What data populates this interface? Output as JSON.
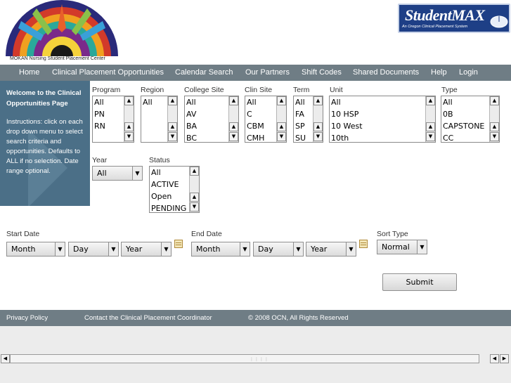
{
  "header": {
    "org_caption": "MOKAN Nursing Student Placement Center",
    "sm_logo_title": "StudentMAX",
    "sm_logo_subtitle": "An Oregon Clinical Placement System"
  },
  "nav": {
    "items": [
      "Home",
      "Clinical Placement Opportunities",
      "Calendar Search",
      "Our Partners",
      "Shift Codes",
      "Shared Documents",
      "Help",
      "Login"
    ]
  },
  "sidebar": {
    "title": "Welcome to the Clinical Opportunities Page",
    "instructions": "Instructions: click on each drop down menu to select search criteria and opportunities. Defaults to ALL if no selection. Date range optional."
  },
  "filters": {
    "program": {
      "label": "Program",
      "options": [
        "All",
        "PN",
        "RN"
      ]
    },
    "region": {
      "label": "Region",
      "options": [
        "All"
      ]
    },
    "college_site": {
      "label": "College Site",
      "options": [
        "All",
        "AV",
        "BA",
        "BC"
      ]
    },
    "clin_site": {
      "label": "Clin Site",
      "options": [
        "All",
        "C",
        "CBM",
        "CMH"
      ]
    },
    "term": {
      "label": "Term",
      "options": [
        "All",
        "FA",
        "SP",
        "SU"
      ]
    },
    "unit": {
      "label": "Unit",
      "options": [
        "All",
        "10 HSP",
        "10 West",
        "10th"
      ]
    },
    "type": {
      "label": "Type",
      "options": [
        "All",
        "0B",
        "CAPSTONE",
        "CC"
      ]
    },
    "year": {
      "label": "Year",
      "value": "All"
    },
    "status": {
      "label": "Status",
      "options": [
        "All",
        "ACTIVE",
        "Open",
        "PENDING"
      ]
    }
  },
  "dates": {
    "start": {
      "label": "Start Date",
      "month": "Month",
      "day": "Day",
      "year": "Year"
    },
    "end": {
      "label": "End Date",
      "month": "Month",
      "day": "Day",
      "year": "Year"
    },
    "sort": {
      "label": "Sort Type",
      "value": "Normal"
    }
  },
  "submit_label": "Submit",
  "footer": {
    "privacy": "Privacy Policy",
    "contact": "Contact the Clinical Placement Coordinator",
    "copyright": "© 2008 OCN, All Rights Reserved"
  },
  "scrollbar": {
    "grip": "⋮⋮⋮⋮"
  },
  "icons": {
    "scroll_up": "▲",
    "scroll_down": "▼",
    "dropdown": "▼",
    "left": "◀",
    "right": "▶",
    "calendar": "calendar-icon"
  },
  "colors": {
    "nav_bg": "#6f7d85",
    "sidebar_bg": "#4b6f87",
    "studentmax_bg": "#1e3f86"
  }
}
